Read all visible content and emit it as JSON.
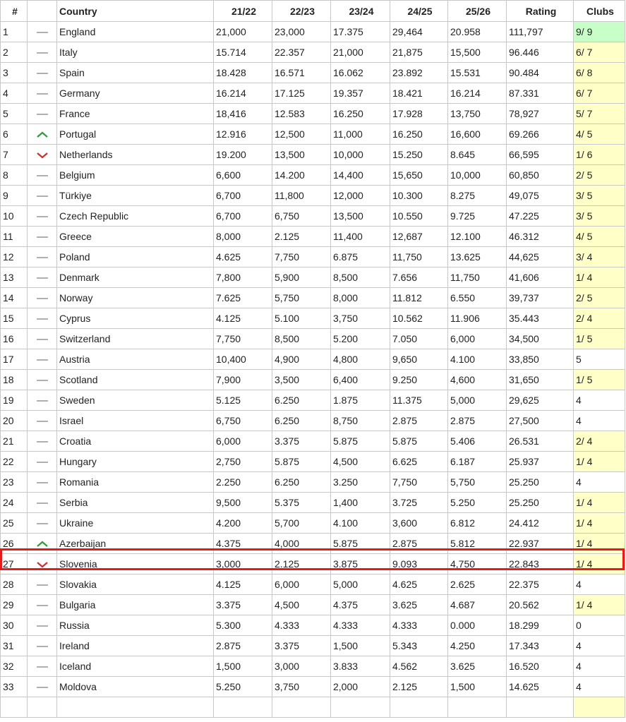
{
  "headers": [
    "#",
    "",
    "Country",
    "21/22",
    "22/23",
    "23/24",
    "24/25",
    "25/26",
    "Rating",
    "Clubs"
  ],
  "colors": {
    "up": "#2e9e3a",
    "down": "#d03030",
    "same": "#b0b0b0",
    "clubs_partial": "#ffffc8",
    "clubs_full": "#c8ffc8",
    "highlight": "#e31b1b"
  },
  "rows": [
    {
      "rank": "1",
      "trend": "same",
      "country": "England",
      "y1": "21,000",
      "y2": "23,000",
      "y3": "17.375",
      "y4": "29,464",
      "y5": "20.958",
      "rating": "111,797",
      "clubs": "9/ 9",
      "clubs_bg": "full"
    },
    {
      "rank": "2",
      "trend": "same",
      "country": "Italy",
      "y1": "15.714",
      "y2": "22.357",
      "y3": "21,000",
      "y4": "21,875",
      "y5": "15,500",
      "rating": "96.446",
      "clubs": "6/ 7",
      "clubs_bg": "partial"
    },
    {
      "rank": "3",
      "trend": "same",
      "country": "Spain",
      "y1": "18.428",
      "y2": "16.571",
      "y3": "16.062",
      "y4": "23.892",
      "y5": "15.531",
      "rating": "90.484",
      "clubs": "6/ 8",
      "clubs_bg": "partial"
    },
    {
      "rank": "4",
      "trend": "same",
      "country": "Germany",
      "y1": "16.214",
      "y2": "17.125",
      "y3": "19.357",
      "y4": "18.421",
      "y5": "16.214",
      "rating": "87.331",
      "clubs": "6/ 7",
      "clubs_bg": "partial"
    },
    {
      "rank": "5",
      "trend": "same",
      "country": "France",
      "y1": "18,416",
      "y2": "12.583",
      "y3": "16.250",
      "y4": "17.928",
      "y5": "13,750",
      "rating": "78,927",
      "clubs": "5/ 7",
      "clubs_bg": "partial"
    },
    {
      "rank": "6",
      "trend": "up",
      "country": "Portugal",
      "y1": "12.916",
      "y2": "12,500",
      "y3": "11,000",
      "y4": "16.250",
      "y5": "16,600",
      "rating": "69.266",
      "clubs": "4/ 5",
      "clubs_bg": "partial"
    },
    {
      "rank": "7",
      "trend": "down",
      "country": "Netherlands",
      "y1": "19.200",
      "y2": "13,500",
      "y3": "10,000",
      "y4": "15.250",
      "y5": "8.645",
      "rating": "66,595",
      "clubs": "1/ 6",
      "clubs_bg": "partial"
    },
    {
      "rank": "8",
      "trend": "same",
      "country": "Belgium",
      "y1": "6,600",
      "y2": "14.200",
      "y3": "14,400",
      "y4": "15,650",
      "y5": "10,000",
      "rating": "60,850",
      "clubs": "2/ 5",
      "clubs_bg": "partial"
    },
    {
      "rank": "9",
      "trend": "same",
      "country": "Türkiye",
      "y1": "6,700",
      "y2": "11,800",
      "y3": "12,000",
      "y4": "10.300",
      "y5": "8.275",
      "rating": "49,075",
      "clubs": "3/ 5",
      "clubs_bg": "partial"
    },
    {
      "rank": "10",
      "trend": "same",
      "country": "Czech Republic",
      "y1": "6,700",
      "y2": "6,750",
      "y3": "13,500",
      "y4": "10.550",
      "y5": "9.725",
      "rating": "47.225",
      "clubs": "3/ 5",
      "clubs_bg": "partial"
    },
    {
      "rank": "11",
      "trend": "same",
      "country": "Greece",
      "y1": "8,000",
      "y2": "2.125",
      "y3": "11,400",
      "y4": "12,687",
      "y5": "12.100",
      "rating": "46.312",
      "clubs": "4/ 5",
      "clubs_bg": "partial"
    },
    {
      "rank": "12",
      "trend": "same",
      "country": "Poland",
      "y1": "4.625",
      "y2": "7,750",
      "y3": "6.875",
      "y4": "11,750",
      "y5": "13.625",
      "rating": "44,625",
      "clubs": "3/ 4",
      "clubs_bg": "partial"
    },
    {
      "rank": "13",
      "trend": "same",
      "country": "Denmark",
      "y1": "7,800",
      "y2": "5,900",
      "y3": "8,500",
      "y4": "7.656",
      "y5": "11,750",
      "rating": "41,606",
      "clubs": "1/ 4",
      "clubs_bg": "partial"
    },
    {
      "rank": "14",
      "trend": "same",
      "country": "Norway",
      "y1": "7.625",
      "y2": "5,750",
      "y3": "8,000",
      "y4": "11.812",
      "y5": "6.550",
      "rating": "39,737",
      "clubs": "2/ 5",
      "clubs_bg": "partial"
    },
    {
      "rank": "15",
      "trend": "same",
      "country": "Cyprus",
      "y1": "4.125",
      "y2": "5.100",
      "y3": "3,750",
      "y4": "10.562",
      "y5": "11.906",
      "rating": "35.443",
      "clubs": "2/ 4",
      "clubs_bg": "partial"
    },
    {
      "rank": "16",
      "trend": "same",
      "country": "Switzerland",
      "y1": "7,750",
      "y2": "8,500",
      "y3": "5.200",
      "y4": "7.050",
      "y5": "6,000",
      "rating": "34,500",
      "clubs": "1/ 5",
      "clubs_bg": "partial"
    },
    {
      "rank": "17",
      "trend": "same",
      "country": "Austria",
      "y1": "10,400",
      "y2": "4,900",
      "y3": "4,800",
      "y4": "9,650",
      "y5": "4.100",
      "rating": "33,850",
      "clubs": "5",
      "clubs_bg": "none"
    },
    {
      "rank": "18",
      "trend": "same",
      "country": "Scotland",
      "y1": "7,900",
      "y2": "3,500",
      "y3": "6,400",
      "y4": "9.250",
      "y5": "4,600",
      "rating": "31,650",
      "clubs": "1/ 5",
      "clubs_bg": "partial"
    },
    {
      "rank": "19",
      "trend": "same",
      "country": "Sweden",
      "y1": "5.125",
      "y2": "6.250",
      "y3": "1.875",
      "y4": "11.375",
      "y5": "5,000",
      "rating": "29,625",
      "clubs": "4",
      "clubs_bg": "none"
    },
    {
      "rank": "20",
      "trend": "same",
      "country": "Israel",
      "y1": "6,750",
      "y2": "6.250",
      "y3": "8,750",
      "y4": "2.875",
      "y5": "2.875",
      "rating": "27,500",
      "clubs": "4",
      "clubs_bg": "none"
    },
    {
      "rank": "21",
      "trend": "same",
      "country": "Croatia",
      "y1": "6,000",
      "y2": "3.375",
      "y3": "5.875",
      "y4": "5.875",
      "y5": "5.406",
      "rating": "26.531",
      "clubs": "2/ 4",
      "clubs_bg": "partial"
    },
    {
      "rank": "22",
      "trend": "same",
      "country": "Hungary",
      "y1": "2,750",
      "y2": "5.875",
      "y3": "4,500",
      "y4": "6.625",
      "y5": "6.187",
      "rating": "25.937",
      "clubs": "1/ 4",
      "clubs_bg": "partial"
    },
    {
      "rank": "23",
      "trend": "same",
      "country": "Romania",
      "y1": "2.250",
      "y2": "6.250",
      "y3": "3.250",
      "y4": "7,750",
      "y5": "5,750",
      "rating": "25.250",
      "clubs": "4",
      "clubs_bg": "none"
    },
    {
      "rank": "24",
      "trend": "same",
      "country": "Serbia",
      "y1": "9,500",
      "y2": "5.375",
      "y3": "1,400",
      "y4": "3.725",
      "y5": "5.250",
      "rating": "25.250",
      "clubs": "1/ 4",
      "clubs_bg": "partial"
    },
    {
      "rank": "25",
      "trend": "same",
      "country": "Ukraine",
      "y1": "4.200",
      "y2": "5,700",
      "y3": "4.100",
      "y4": "3,600",
      "y5": "6.812",
      "rating": "24.412",
      "clubs": "1/ 4",
      "clubs_bg": "partial"
    },
    {
      "rank": "26",
      "trend": "up",
      "country": "Azerbaijan",
      "y1": "4.375",
      "y2": "4,000",
      "y3": "5.875",
      "y4": "2.875",
      "y5": "5.812",
      "rating": "22.937",
      "clubs": "1/ 4",
      "clubs_bg": "partial"
    },
    {
      "rank": "27",
      "trend": "down",
      "country": "Slovenia",
      "y1": "3,000",
      "y2": "2.125",
      "y3": "3.875",
      "y4": "9.093",
      "y5": "4,750",
      "rating": "22.843",
      "clubs": "1/ 4",
      "clubs_bg": "partial"
    },
    {
      "rank": "28",
      "trend": "same",
      "country": "Slovakia",
      "y1": "4.125",
      "y2": "6,000",
      "y3": "5,000",
      "y4": "4.625",
      "y5": "2.625",
      "rating": "22.375",
      "clubs": "4",
      "clubs_bg": "none"
    },
    {
      "rank": "29",
      "trend": "same",
      "country": "Bulgaria",
      "y1": "3.375",
      "y2": "4,500",
      "y3": "4.375",
      "y4": "3.625",
      "y5": "4.687",
      "rating": "20.562",
      "clubs": "1/ 4",
      "clubs_bg": "partial"
    },
    {
      "rank": "30",
      "trend": "same",
      "country": "Russia",
      "y1": "5.300",
      "y2": "4.333",
      "y3": "4.333",
      "y4": "4.333",
      "y5": "0.000",
      "rating": "18.299",
      "clubs": "0",
      "clubs_bg": "none"
    },
    {
      "rank": "31",
      "trend": "same",
      "country": "Ireland",
      "y1": "2.875",
      "y2": "3.375",
      "y3": "1,500",
      "y4": "5.343",
      "y5": "4.250",
      "rating": "17.343",
      "clubs": "4",
      "clubs_bg": "none"
    },
    {
      "rank": "32",
      "trend": "same",
      "country": "Iceland",
      "y1": "1,500",
      "y2": "3,000",
      "y3": "3.833",
      "y4": "4.562",
      "y5": "3.625",
      "rating": "16.520",
      "clubs": "4",
      "clubs_bg": "none"
    },
    {
      "rank": "33",
      "trend": "same",
      "country": "Moldova",
      "y1": "5.250",
      "y2": "3,750",
      "y3": "2,000",
      "y4": "2.125",
      "y5": "1,500",
      "rating": "14.625",
      "clubs": "4",
      "clubs_bg": "none"
    },
    {
      "rank": "",
      "trend": "none",
      "country": "",
      "y1": "",
      "y2": "",
      "y3": "",
      "y4": "",
      "y5": "",
      "rating": "",
      "clubs": "",
      "clubs_bg": "partial"
    }
  ]
}
